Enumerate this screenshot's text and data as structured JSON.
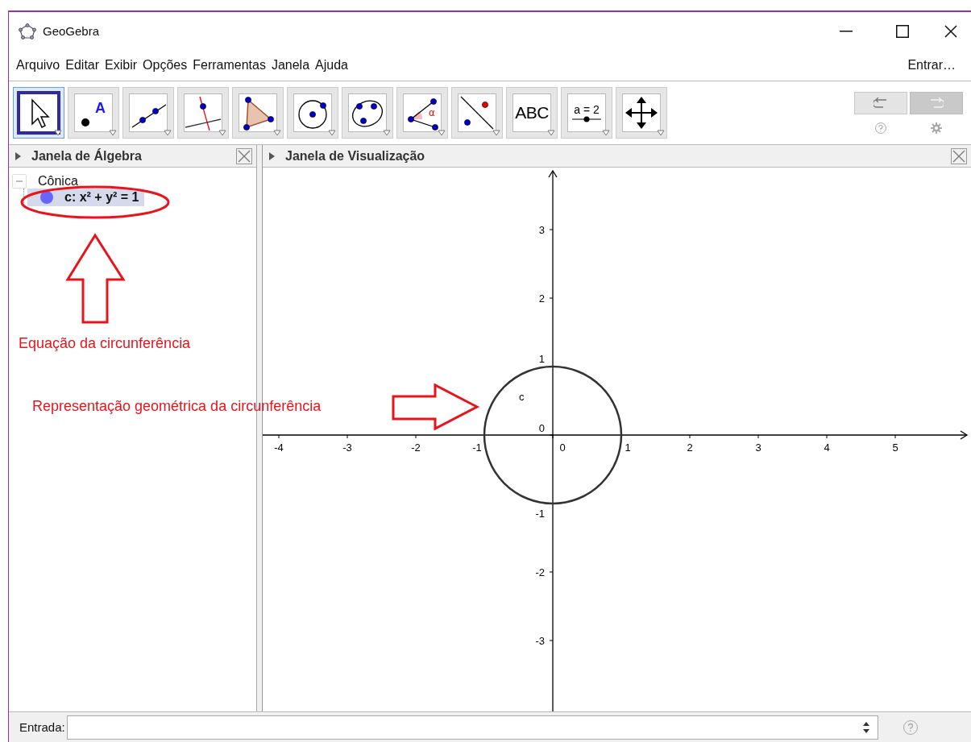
{
  "window": {
    "title": "GeoGebra"
  },
  "menu": {
    "items": [
      "Arquivo",
      "Editar",
      "Exibir",
      "Opções",
      "Ferramentas",
      "Janela",
      "Ajuda"
    ],
    "sign_in": "Entrar…"
  },
  "toolbar": {
    "tools": [
      {
        "kind": "move",
        "selected": true
      },
      {
        "kind": "point",
        "label": "A",
        "selected": false
      },
      {
        "kind": "line",
        "selected": false
      },
      {
        "kind": "perpendicular",
        "selected": false
      },
      {
        "kind": "polygon",
        "selected": false
      },
      {
        "kind": "circle",
        "selected": false
      },
      {
        "kind": "conic",
        "selected": false
      },
      {
        "kind": "angle",
        "label": "α",
        "selected": false
      },
      {
        "kind": "reflect",
        "selected": false
      },
      {
        "kind": "text",
        "label": "ABC",
        "selected": false
      },
      {
        "kind": "slider",
        "label": "a = 2",
        "selected": false
      },
      {
        "kind": "move-view",
        "selected": false
      }
    ],
    "undo": {
      "disabled": false
    },
    "redo": {
      "disabled": true
    }
  },
  "algebra": {
    "title": "Janela de Álgebra",
    "groups": [
      {
        "label": "Cônica",
        "expanded": true,
        "children": [
          {
            "label": "c: x² + y² = 1",
            "color": "#6666ff",
            "selected": true
          }
        ]
      }
    ]
  },
  "graphics": {
    "title": "Janela de Visualização",
    "x_labels": [
      "-4",
      "-3",
      "-2",
      "-1",
      "0",
      "1",
      "2",
      "3",
      "4",
      "5"
    ],
    "y_labels": [
      "3",
      "2",
      "1",
      "0",
      "-1",
      "-2",
      "-3"
    ],
    "objects": [
      {
        "kind": "circle",
        "label": "c"
      }
    ]
  },
  "annotations": [
    {
      "kind": "highlight-ellipse"
    },
    {
      "kind": "up-arrow"
    },
    {
      "kind": "note",
      "text": "Equação da circunferência"
    },
    {
      "kind": "note",
      "text": "Representação geométrica da circunferência"
    },
    {
      "kind": "right-arrow"
    }
  ],
  "input_bar": {
    "label": "Entrada:"
  }
}
